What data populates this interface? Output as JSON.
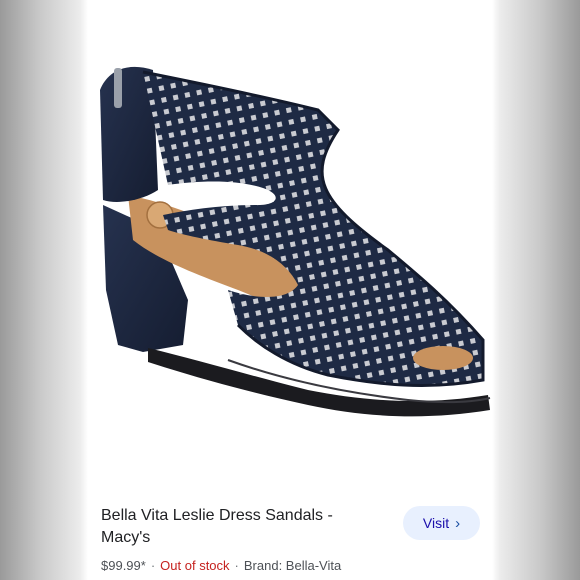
{
  "product": {
    "image_alt": "Navy perforated suede block-heel dress sandal",
    "title": "Bella Vita Leslie Dress Sandals - Macy's",
    "price": "$99.99*",
    "stock_status": "Out of stock",
    "brand": "Brand: Bella-Vita",
    "separator": "·"
  },
  "actions": {
    "visit_label": "Visit",
    "visit_icon": "chevron-right-icon"
  },
  "colors": {
    "suede": "#1e2a44",
    "stock_red": "#c5221f",
    "button_bg": "#e8f0fe",
    "link_blue": "#1a0dab"
  }
}
